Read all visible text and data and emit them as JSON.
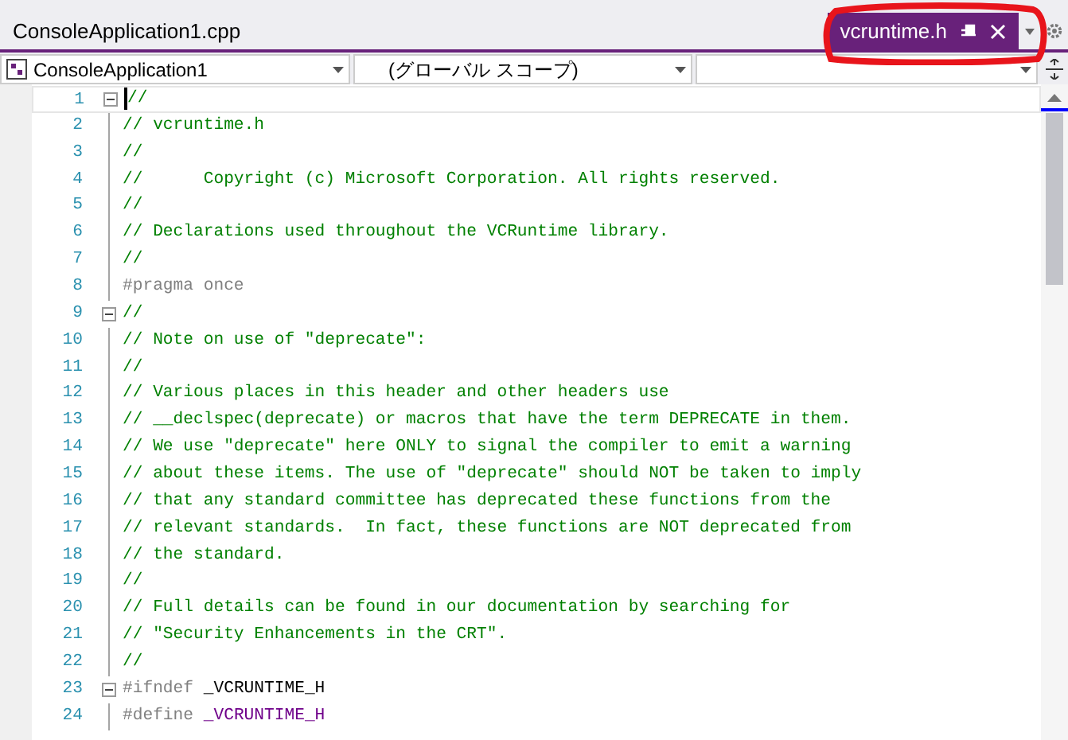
{
  "tabs": [
    {
      "label": "ConsoleApplication1.cpp",
      "selected": false
    },
    {
      "label": "vcruntime.h",
      "selected": true
    }
  ],
  "annotation": {
    "kind": "circle",
    "color": "#e8141b"
  },
  "nav_bar": {
    "project": "ConsoleApplication1",
    "scope": "(グローバル スコープ)"
  },
  "editor": {
    "lines": [
      {
        "number": "1",
        "fold": true,
        "cursor": true,
        "tokens": [
          {
            "kind": "comment",
            "text": "//"
          }
        ]
      },
      {
        "number": "2",
        "fold": false,
        "cursor": false,
        "tokens": [
          {
            "kind": "comment",
            "text": "// vcruntime.h"
          }
        ]
      },
      {
        "number": "3",
        "fold": false,
        "cursor": false,
        "tokens": [
          {
            "kind": "comment",
            "text": "//"
          }
        ]
      },
      {
        "number": "4",
        "fold": false,
        "cursor": false,
        "tokens": [
          {
            "kind": "comment",
            "text": "//      Copyright (c) Microsoft Corporation. All rights reserved."
          }
        ]
      },
      {
        "number": "5",
        "fold": false,
        "cursor": false,
        "tokens": [
          {
            "kind": "comment",
            "text": "//"
          }
        ]
      },
      {
        "number": "6",
        "fold": false,
        "cursor": false,
        "tokens": [
          {
            "kind": "comment",
            "text": "// Declarations used throughout the VCRuntime library."
          }
        ]
      },
      {
        "number": "7",
        "fold": false,
        "cursor": false,
        "tokens": [
          {
            "kind": "comment",
            "text": "//"
          }
        ]
      },
      {
        "number": "8",
        "fold": false,
        "cursor": false,
        "tokens": [
          {
            "kind": "preprocessor",
            "text": "#pragma once"
          }
        ]
      },
      {
        "number": "9",
        "fold": true,
        "cursor": false,
        "tokens": [
          {
            "kind": "comment",
            "text": "//"
          }
        ]
      },
      {
        "number": "10",
        "fold": false,
        "cursor": false,
        "tokens": [
          {
            "kind": "comment",
            "text": "// Note on use of \"deprecate\":"
          }
        ]
      },
      {
        "number": "11",
        "fold": false,
        "cursor": false,
        "tokens": [
          {
            "kind": "comment",
            "text": "//"
          }
        ]
      },
      {
        "number": "12",
        "fold": false,
        "cursor": false,
        "tokens": [
          {
            "kind": "comment",
            "text": "// Various places in this header and other headers use"
          }
        ]
      },
      {
        "number": "13",
        "fold": false,
        "cursor": false,
        "tokens": [
          {
            "kind": "comment",
            "text": "// __declspec(deprecate) or macros that have the term DEPRECATE in them."
          }
        ]
      },
      {
        "number": "14",
        "fold": false,
        "cursor": false,
        "tokens": [
          {
            "kind": "comment",
            "text": "// We use \"deprecate\" here ONLY to signal the compiler to emit a warning"
          }
        ]
      },
      {
        "number": "15",
        "fold": false,
        "cursor": false,
        "tokens": [
          {
            "kind": "comment",
            "text": "// about these items. The use of \"deprecate\" should NOT be taken to imply"
          }
        ]
      },
      {
        "number": "16",
        "fold": false,
        "cursor": false,
        "tokens": [
          {
            "kind": "comment",
            "text": "// that any standard committee has deprecated these functions from the"
          }
        ]
      },
      {
        "number": "17",
        "fold": false,
        "cursor": false,
        "tokens": [
          {
            "kind": "comment",
            "text": "// relevant standards.  In fact, these functions are NOT deprecated from"
          }
        ]
      },
      {
        "number": "18",
        "fold": false,
        "cursor": false,
        "tokens": [
          {
            "kind": "comment",
            "text": "// the standard."
          }
        ]
      },
      {
        "number": "19",
        "fold": false,
        "cursor": false,
        "tokens": [
          {
            "kind": "comment",
            "text": "//"
          }
        ]
      },
      {
        "number": "20",
        "fold": false,
        "cursor": false,
        "tokens": [
          {
            "kind": "comment",
            "text": "// Full details can be found in our documentation by searching for"
          }
        ]
      },
      {
        "number": "21",
        "fold": false,
        "cursor": false,
        "tokens": [
          {
            "kind": "comment",
            "text": "// \"Security Enhancements in the CRT\"."
          }
        ]
      },
      {
        "number": "22",
        "fold": false,
        "cursor": false,
        "tokens": [
          {
            "kind": "comment",
            "text": "//"
          }
        ]
      },
      {
        "number": "23",
        "fold": true,
        "cursor": false,
        "tokens": [
          {
            "kind": "preprocessor",
            "text": "#ifndef"
          },
          {
            "kind": "plain",
            "text": " _VCRUNTIME_H"
          }
        ]
      },
      {
        "number": "24",
        "fold": false,
        "cursor": false,
        "tokens": [
          {
            "kind": "preprocessor",
            "text": "#define"
          },
          {
            "kind": "macro",
            "text": " _VCRUNTIME_H"
          }
        ]
      }
    ]
  }
}
